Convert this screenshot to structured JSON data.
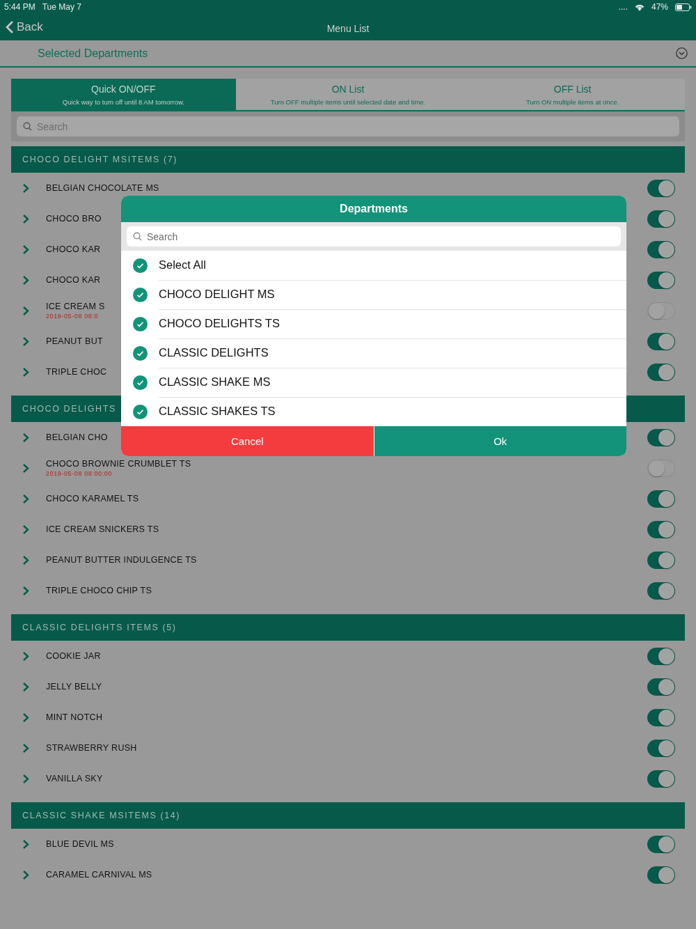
{
  "status_bar": {
    "time": "5:44 PM",
    "date": "Tue May 7",
    "signal": "....",
    "battery": "47%"
  },
  "nav": {
    "back": "Back",
    "title": "Menu List"
  },
  "filter": {
    "label": "Selected Departments"
  },
  "tabs": [
    {
      "label": "Quick ON/OFF",
      "hint": "Quick way to turn off until 8 AM tomorrow.",
      "selected": true
    },
    {
      "label": "ON List",
      "hint": "Turn OFF multiple items until selected date and time.",
      "selected": false
    },
    {
      "label": "OFF List",
      "hint": "Turn ON multiple items at once.",
      "selected": false
    }
  ],
  "search": {
    "placeholder": "Search"
  },
  "sections": [
    {
      "title": "CHOCO DELIGHT MSITEMS (7)",
      "items": [
        {
          "name": "BELGIAN CHOCOLATE MS",
          "on": true
        },
        {
          "name": "CHOCO BRO",
          "on": true
        },
        {
          "name": "CHOCO KAR",
          "on": true
        },
        {
          "name": "CHOCO KAR",
          "on": true
        },
        {
          "name": "ICE CREAM S",
          "date": "2019-05-08 08:0",
          "on": false
        },
        {
          "name": "PEANUT BUT",
          "on": true
        },
        {
          "name": "TRIPLE CHOC",
          "on": true
        }
      ]
    },
    {
      "title": "CHOCO DELIGHTS",
      "items": [
        {
          "name": "BELGIAN CHO",
          "on": true
        },
        {
          "name": "CHOCO BROWNIE CRUMBLET TS",
          "date": "2019-05-08 08:00:00",
          "on": false
        },
        {
          "name": "CHOCO KARAMEL TS",
          "on": true
        },
        {
          "name": "ICE CREAM SNICKERS TS",
          "on": true
        },
        {
          "name": "PEANUT BUTTER INDULGENCE TS",
          "on": true
        },
        {
          "name": "TRIPLE CHOCO CHIP TS",
          "on": true
        }
      ]
    },
    {
      "title": "CLASSIC DELIGHTS ITEMS (5)",
      "items": [
        {
          "name": "COOKIE JAR",
          "on": true
        },
        {
          "name": "JELLY BELLY",
          "on": true
        },
        {
          "name": "MINT NOTCH",
          "on": true
        },
        {
          "name": "STRAWBERRY RUSH",
          "on": true
        },
        {
          "name": "VANILLA SKY",
          "on": true
        }
      ]
    },
    {
      "title": "CLASSIC SHAKE MSITEMS (14)",
      "items": [
        {
          "name": "BLUE DEVIL MS",
          "on": true
        },
        {
          "name": "CARAMEL CARNIVAL MS",
          "on": true
        }
      ]
    }
  ],
  "dialog": {
    "title": "Departments",
    "search": {
      "placeholder": "Search"
    },
    "options": [
      {
        "label": "Select All",
        "checked": true
      },
      {
        "label": "CHOCO DELIGHT MS",
        "checked": true
      },
      {
        "label": "CHOCO DELIGHTS TS",
        "checked": true
      },
      {
        "label": "CLASSIC DELIGHTS",
        "checked": true
      },
      {
        "label": "CLASSIC SHAKE MS",
        "checked": true
      },
      {
        "label": "CLASSIC SHAKES TS",
        "checked": true
      }
    ],
    "buttons": [
      {
        "label": "Cancel",
        "kind": "cancel"
      },
      {
        "label": "Ok",
        "kind": "confirm"
      }
    ]
  }
}
